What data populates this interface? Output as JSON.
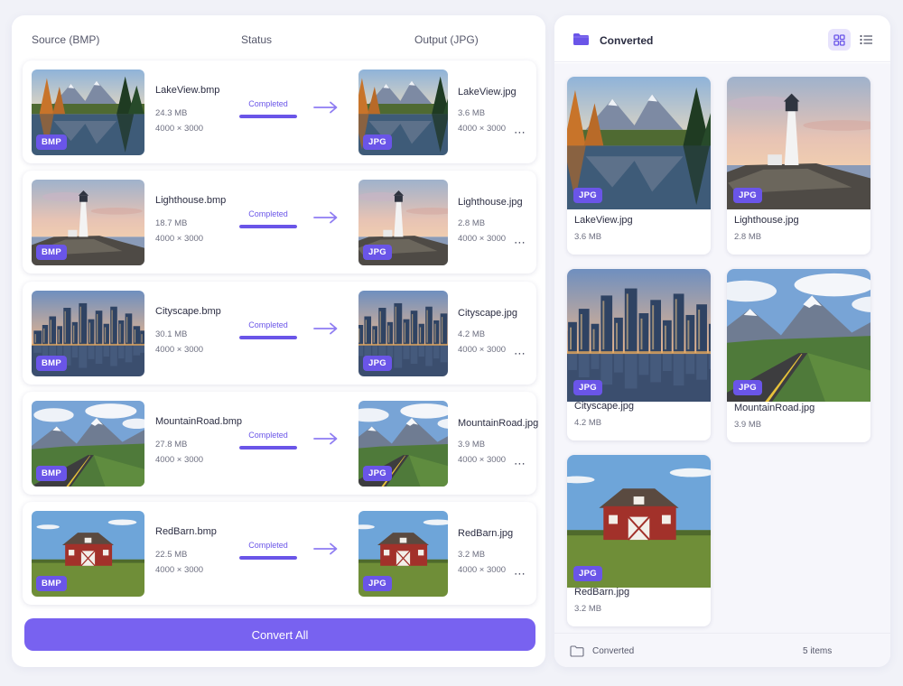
{
  "columns": {
    "source": "Source (BMP)",
    "status": "Status",
    "output": "Output (JPG)"
  },
  "conversions": [
    {
      "scene": "lake",
      "src_name": "LakeView.bmp",
      "src_size": "24.3 MB",
      "src_dims": "4000 × 3000",
      "status": "Completed",
      "progress": 1.0,
      "out_name": "LakeView.jpg",
      "out_size": "3.6 MB",
      "out_dims": "4000 × 3000"
    },
    {
      "scene": "lighthouse",
      "src_name": "Lighthouse.bmp",
      "src_size": "18.7 MB",
      "src_dims": "4000 × 3000",
      "status": "Completed",
      "progress": 1.0,
      "out_name": "Lighthouse.jpg",
      "out_size": "2.8 MB",
      "out_dims": "4000 × 3000"
    },
    {
      "scene": "city",
      "src_name": "Cityscape.bmp",
      "src_size": "30.1 MB",
      "src_dims": "4000 × 3000",
      "status": "Completed",
      "progress": 1.0,
      "out_name": "Cityscape.jpg",
      "out_size": "4.2 MB",
      "out_dims": "4000 × 3000"
    },
    {
      "scene": "mountain",
      "src_name": "MountainRoad.bmp",
      "src_size": "27.8 MB",
      "src_dims": "4000 × 3000",
      "status": "Completed",
      "progress": 1.0,
      "out_name": "MountainRoad.jpg",
      "out_size": "3.9 MB",
      "out_dims": "4000 × 3000"
    },
    {
      "scene": "barn",
      "src_name": "RedBarn.bmp",
      "src_size": "22.5 MB",
      "src_dims": "4000 × 3000",
      "status": "Completed",
      "progress": 1.0,
      "out_name": "RedBarn.jpg",
      "out_size": "3.2 MB",
      "out_dims": "4000 × 3000"
    }
  ],
  "badges": {
    "source": "BMP",
    "output": "JPG"
  },
  "convert_all_label": "Convert All",
  "converted_panel": {
    "title": "Converted",
    "view_modes": [
      "grid-icon",
      "list-icon"
    ],
    "active_view": "grid",
    "files": [
      {
        "scene": "lake",
        "name": "LakeView.jpg",
        "size": "3.6 MB",
        "badge": "JPG"
      },
      {
        "scene": "lighthouse",
        "name": "Lighthouse.jpg",
        "size": "2.8 MB",
        "badge": "JPG"
      },
      {
        "scene": "city",
        "name": "Cityscape.jpg",
        "size": "4.2 MB",
        "badge": "JPG"
      },
      {
        "scene": "mountain",
        "name": "MountainRoad.jpg",
        "size": "3.9 MB",
        "badge": "JPG"
      },
      {
        "scene": "barn",
        "name": "RedBarn.jpg",
        "size": "3.2 MB",
        "badge": "JPG"
      }
    ],
    "footer_folder": "Converted",
    "footer_count": "5 items"
  },
  "colors": {
    "accent": "#6a55e8",
    "button": "#7862f0",
    "badge": "#6a55e8"
  }
}
